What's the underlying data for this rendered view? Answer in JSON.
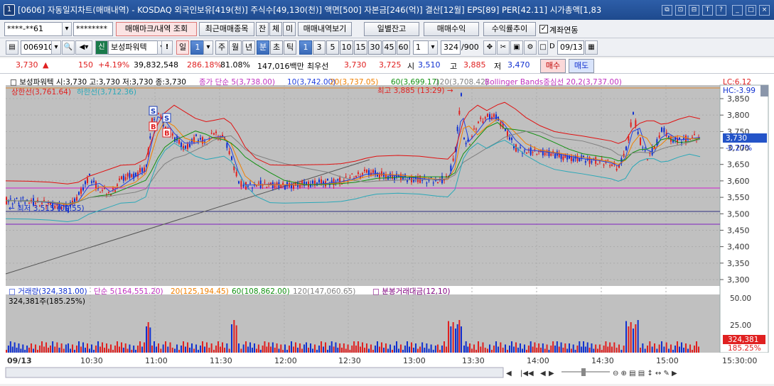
{
  "window": {
    "number": "1",
    "title": "[0606] 자동일지차트(매매내역) - KOSDAQ 외국인보유[419(천)] 주식수[49,130(천)] 액면[500] 자본금[246(억)] 결산[12월] EPS[89] PER[42.11] 시가총액[1,83",
    "controls": [
      "⧉",
      "⊡",
      "⊟",
      "T",
      "?",
      "_",
      "□",
      "×"
    ]
  },
  "toolbar1": {
    "account": "****-**61",
    "password": "********",
    "trade_mark_btn": "매매마크/내역 조회",
    "recent_btn": "최근매매종목",
    "mini_btns": [
      "잔",
      "체",
      "미"
    ],
    "history_btn": "매매내역보기",
    "daily_balance_btn": "일별잔고",
    "daily_return_btn": "매매수익",
    "return_trend_btn": "수익률추이",
    "account_link_label": "계좌연동"
  },
  "toolbar2": {
    "code": "006910",
    "stock_name": "보성파워텍",
    "period_btns": [
      "일",
      "주",
      "월",
      "년",
      "분",
      "초",
      "틱"
    ],
    "period_value": "1",
    "minute_btns": [
      "1",
      "3",
      "5",
      "10",
      "15",
      "30",
      "45",
      "60"
    ],
    "count_value": "1",
    "bars": "324",
    "bars_total": "/900",
    "date": "09/13"
  },
  "quote": {
    "price": "3,730",
    "change": "150",
    "change_pct": "+4.19%",
    "volume": "39,832,548",
    "vol_ratio": "286.18%",
    "turnover": "81.08%",
    "amount": "147,016백만",
    "best_label": "최우선",
    "ask": "3,730",
    "bid": "3,725",
    "open_label": "시",
    "open": "3,510",
    "high_label": "고",
    "high": "3,885",
    "low_label": "저",
    "low": "3,470",
    "buy_btn": "매수",
    "sell_btn": "매도"
  },
  "chart": {
    "price_legend": {
      "name": "보성파워텍 시:3,730 고:3,730 저:3,730 종:3,730",
      "ma5": "종가 단순 5(3,738.00)",
      "ma10": "10(3,742.00)",
      "ma20": "20(3,737.05)",
      "ma60": "60(3,699.17)",
      "ma120": "120(3,708.42)",
      "bb": "Bollinger Bands중심선 20,2(3,737.00)"
    },
    "upper_band": "상한선(3,761.64)",
    "lower_band": "하한선(3,712.36)",
    "high_mark": "최고 3,885 (13:29)",
    "low_mark": "최저 3,515 (09:55)",
    "lc": "LC:6.12",
    "hc": "HC:-3.99",
    "price_ticks": [
      "3,850",
      "3,800",
      "3,750",
      "3,700",
      "3,650",
      "3,600",
      "3,550",
      "3,500",
      "3,450",
      "3,400",
      "3,350",
      "3,300"
    ],
    "current_price_tag": "3,730",
    "current_pct_tag": "-0.27%",
    "volume_legend": {
      "vol": "거래량(324,381.00)",
      "ma5": "단순 5(164,551.20)",
      "ma20": "20(125,194.45)",
      "ma60": "60(108,862.00)",
      "ma120": "120(147,060.65)",
      "amount": "분봉거래대금(12,10)"
    },
    "volume_sub": "324,381주(185.25%)",
    "vol_ticks": [
      "50.00",
      "25.00"
    ],
    "vol_tag": "324,381",
    "vol_pct_tag": "185.25%",
    "time_ticks": [
      "09/13",
      "10:30",
      "11:00",
      "11:30",
      "12:00",
      "12:30",
      "13:00",
      "13:30",
      "14:00",
      "14:30",
      "15:00",
      "15:30:00"
    ],
    "trade_marks": [
      "S",
      "B",
      "S",
      "B"
    ],
    "colors": {
      "up": "#e02020",
      "down": "#1030d0",
      "bg": "#c0c0c0",
      "ma5": "#c030c0",
      "ma10": "#2040e0",
      "ma20": "#f08000",
      "ma60": "#109010",
      "ma120": "#808080",
      "bb": "#e01010"
    }
  }
}
